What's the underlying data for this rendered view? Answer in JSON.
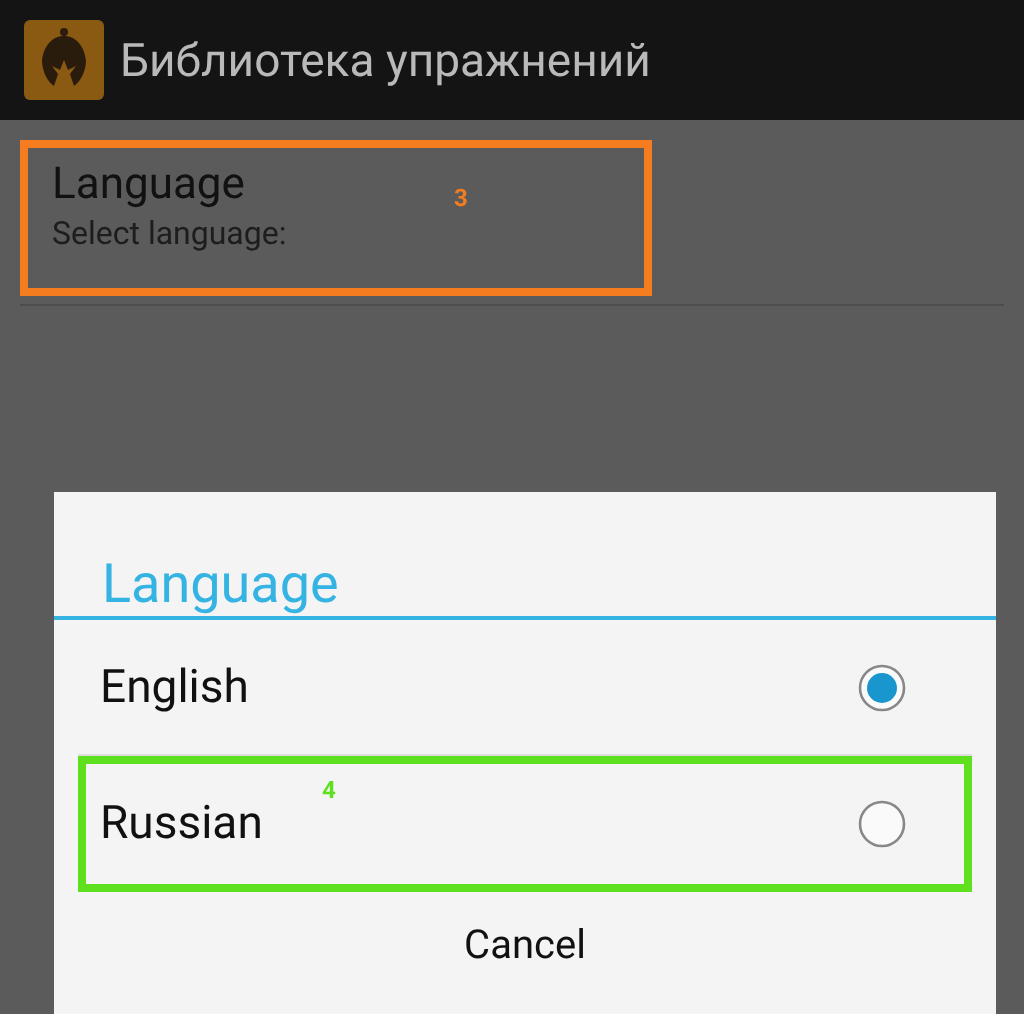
{
  "action_bar": {
    "title": "Библиотека упражнений"
  },
  "preference": {
    "title": "Language",
    "summary": "Select language:",
    "annotation": {
      "label": "3",
      "color": "#f57c1f"
    }
  },
  "dialog": {
    "title": "Language",
    "options": [
      {
        "label": "English",
        "selected": true
      },
      {
        "label": "Russian",
        "selected": false,
        "annotation": {
          "label": "4",
          "color": "#5ee01e"
        }
      }
    ],
    "buttons": [
      "Cancel"
    ]
  }
}
